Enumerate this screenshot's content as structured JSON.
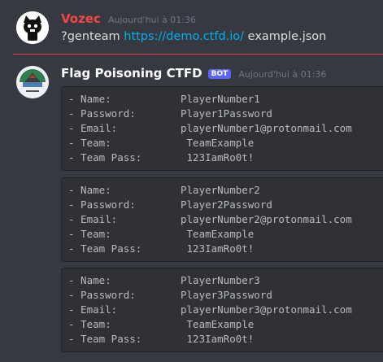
{
  "messages": [
    {
      "author": "Vozec",
      "author_color": "#f04747",
      "timestamp": "Aujourd'hui à 01:36",
      "avatar_icon": "cat-avatar-icon",
      "command": "?genteam",
      "link": "https://demo.ctfd.io/",
      "file_arg": "example.json"
    },
    {
      "author": "Flag Poisoning CTFD",
      "author_color": "#ffffff",
      "bot_tag": "BOT",
      "timestamp": "Aujourd'hui à 01:36",
      "avatar_icon": "island-avatar-icon",
      "blocks": [
        {
          "lines": [
            {
              "key": "- Name:",
              "value": "PlayerNumber1"
            },
            {
              "key": "- Password:",
              "value": "Player1Password"
            },
            {
              "key": "- Email:",
              "value": "playerNumber1@protonmail.com"
            },
            {
              "key": "- Team:",
              "value": " TeamExample"
            },
            {
              "key": "- Team Pass:",
              "value": " 123IamRo0t!"
            }
          ]
        },
        {
          "lines": [
            {
              "key": "- Name:",
              "value": "PlayerNumber2"
            },
            {
              "key": "- Password:",
              "value": "Player2Password"
            },
            {
              "key": "- Email:",
              "value": "playerNumber2@protonmail.com"
            },
            {
              "key": "- Team:",
              "value": " TeamExample"
            },
            {
              "key": "- Team Pass:",
              "value": " 123IamRo0t!"
            }
          ]
        },
        {
          "lines": [
            {
              "key": "- Name:",
              "value": "PlayerNumber3"
            },
            {
              "key": "- Password:",
              "value": "Player3Password"
            },
            {
              "key": "- Email:",
              "value": "playerNumber3@protonmail.com"
            },
            {
              "key": "- Team:",
              "value": " TeamExample"
            },
            {
              "key": "- Team Pass:",
              "value": " 123IamRo0t!"
            }
          ]
        }
      ]
    }
  ]
}
